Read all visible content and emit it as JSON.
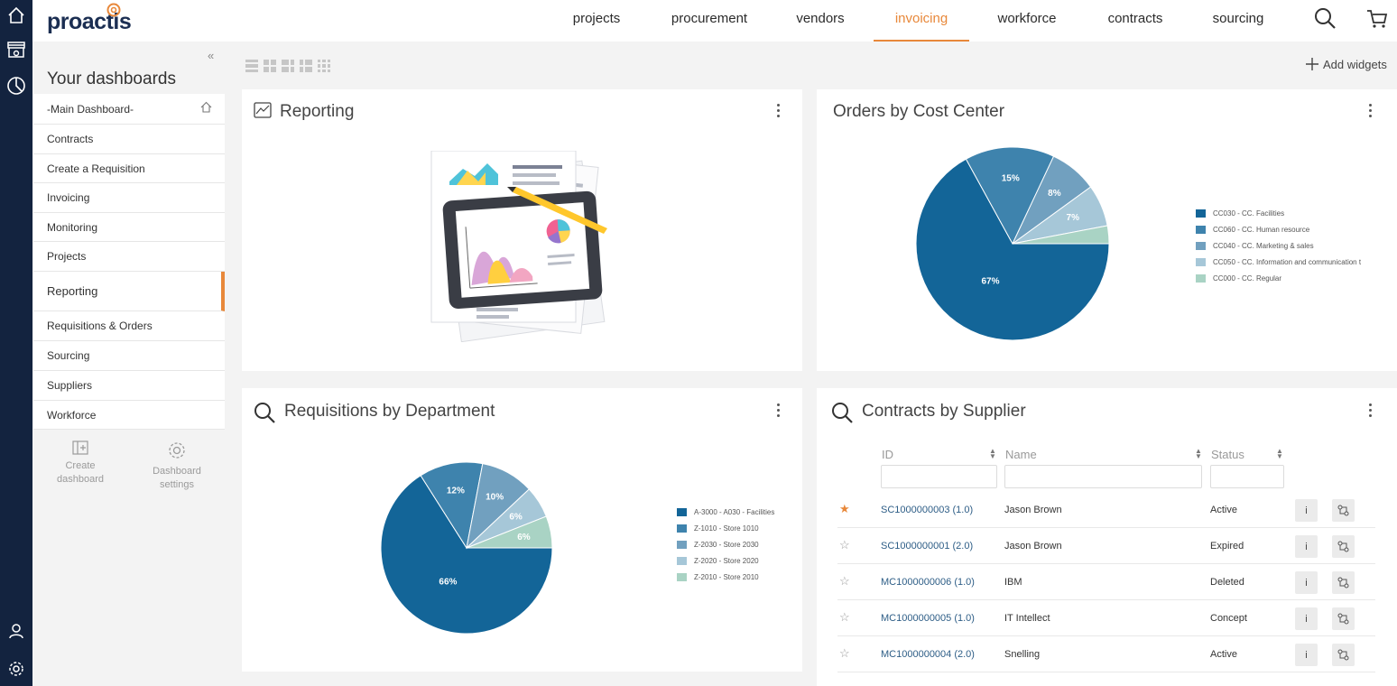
{
  "app": {
    "logo": "proactis"
  },
  "nav": {
    "items": [
      "projects",
      "procurement",
      "vendors",
      "invoicing",
      "workforce",
      "contracts",
      "sourcing"
    ],
    "active": "invoicing"
  },
  "icons": {
    "rail": [
      "home-icon",
      "storefront-icon",
      "pie-chart-icon",
      "user-icon",
      "gear-icon"
    ],
    "top": [
      "search-icon",
      "cart-icon"
    ]
  },
  "sidebar": {
    "title": "Your dashboards",
    "items": [
      "-Main Dashboard-",
      "Contracts",
      "Create a Requisition",
      "Invoicing",
      "Monitoring",
      "Projects",
      "Reporting",
      "Requisitions & Orders",
      "Sourcing",
      "Suppliers",
      "Workforce"
    ],
    "active": "Reporting",
    "create_label": "Create\ndashboard",
    "settings_label": "Dashboard\nsettings"
  },
  "toolbar": {
    "add_widgets": "Add widgets"
  },
  "widgets": {
    "reporting": {
      "title": "Reporting"
    },
    "orders": {
      "title": "Orders by Cost Center",
      "legend": [
        "CC030 - CC. Facilities",
        "CC060 - CC. Human resource",
        "CC040 - CC. Marketing & sales",
        "CC050 - CC. Information and communication t",
        "CC000 - CC. Regular"
      ]
    },
    "requisitions": {
      "title": "Requisitions by Department",
      "legend": [
        "A-3000 - A030 - Facilities",
        "Z-1010 - Store 1010",
        "Z-2030 - Store 2030",
        "Z-2020 - Store 2020",
        "Z-2010 - Store 2010"
      ]
    },
    "contracts": {
      "title": "Contracts by Supplier",
      "columns": [
        "ID",
        "Name",
        "Status"
      ],
      "rows": [
        {
          "id": "SC1000000003 (1.0)",
          "name": "Jason Brown",
          "status": "Active",
          "favorite": true
        },
        {
          "id": "SC1000000001 (2.0)",
          "name": "Jason Brown",
          "status": "Expired",
          "favorite": false
        },
        {
          "id": "MC1000000006 (1.0)",
          "name": "IBM",
          "status": "Deleted",
          "favorite": false
        },
        {
          "id": "MC1000000005 (1.0)",
          "name": "IT Intellect",
          "status": "Concept",
          "favorite": false
        },
        {
          "id": "MC1000000004 (2.0)",
          "name": "Snelling",
          "status": "Active",
          "favorite": false
        }
      ],
      "info_label": "i"
    }
  },
  "colors": {
    "accent": "#e8883a",
    "rail": "#13233f",
    "pie": [
      "#136598",
      "#3e83ad",
      "#71a0bf",
      "#a6c7d8",
      "#a9d3c4"
    ]
  },
  "chart_data": [
    {
      "type": "pie",
      "title": "Orders by Cost Center",
      "categories": [
        "CC030 - CC. Facilities",
        "CC060 - CC. Human resource",
        "CC040 - CC. Marketing & sales",
        "CC050 - CC. Information and communication t",
        "CC000 - CC. Regular"
      ],
      "values": [
        67,
        15,
        8,
        7,
        3
      ],
      "labels": [
        "67%",
        "15%",
        "8%",
        "7%",
        ""
      ],
      "legend": "right"
    },
    {
      "type": "pie",
      "title": "Requisitions by Department",
      "categories": [
        "A-3000 - A030 - Facilities",
        "Z-1010 - Store 1010",
        "Z-2030 - Store 2030",
        "Z-2020 - Store 2020",
        "Z-2010 - Store 2010"
      ],
      "values": [
        66,
        12,
        10,
        6,
        6
      ],
      "labels": [
        "66%",
        "12%",
        "10%",
        "6%",
        "6%"
      ],
      "legend": "right"
    }
  ]
}
